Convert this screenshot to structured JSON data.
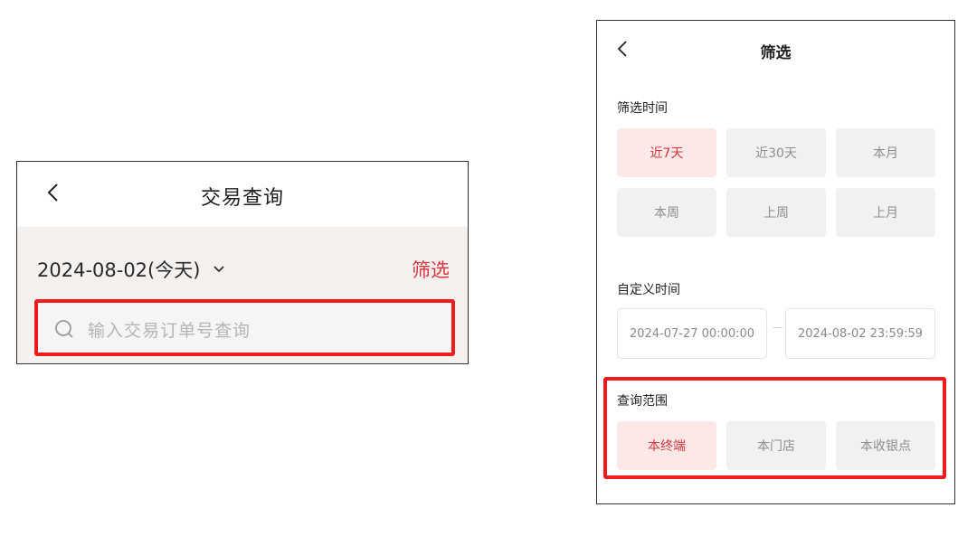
{
  "left_screen": {
    "header": {
      "title": "交易查询",
      "back_icon": "chevron-left-icon"
    },
    "date_selector": {
      "value": "2024-08-02(今天)",
      "icon": "chevron-down-icon"
    },
    "filter_link": "筛选",
    "search": {
      "placeholder": "输入交易订单号查询",
      "icon": "search-icon"
    }
  },
  "right_screen": {
    "header": {
      "title": "筛选",
      "back_icon": "chevron-left-icon"
    },
    "time_section": {
      "label": "筛选时间",
      "options": [
        "近7天",
        "近30天",
        "本月",
        "本周",
        "上周",
        "上月"
      ],
      "selected": "近7天"
    },
    "custom_time_section": {
      "label": "自定义时间",
      "start": "2024-07-27 00:00:00",
      "end": "2024-08-02 23:59:59"
    },
    "scope_section": {
      "label": "查询范围",
      "options": [
        "本终端",
        "本门店",
        "本收银点"
      ],
      "selected": "本终端"
    }
  },
  "colors": {
    "accent": "#d9363e",
    "highlight_box": "#ee1c1c",
    "chip_bg": "#f2f1f0",
    "chip_active_bg": "#fde8e8"
  }
}
